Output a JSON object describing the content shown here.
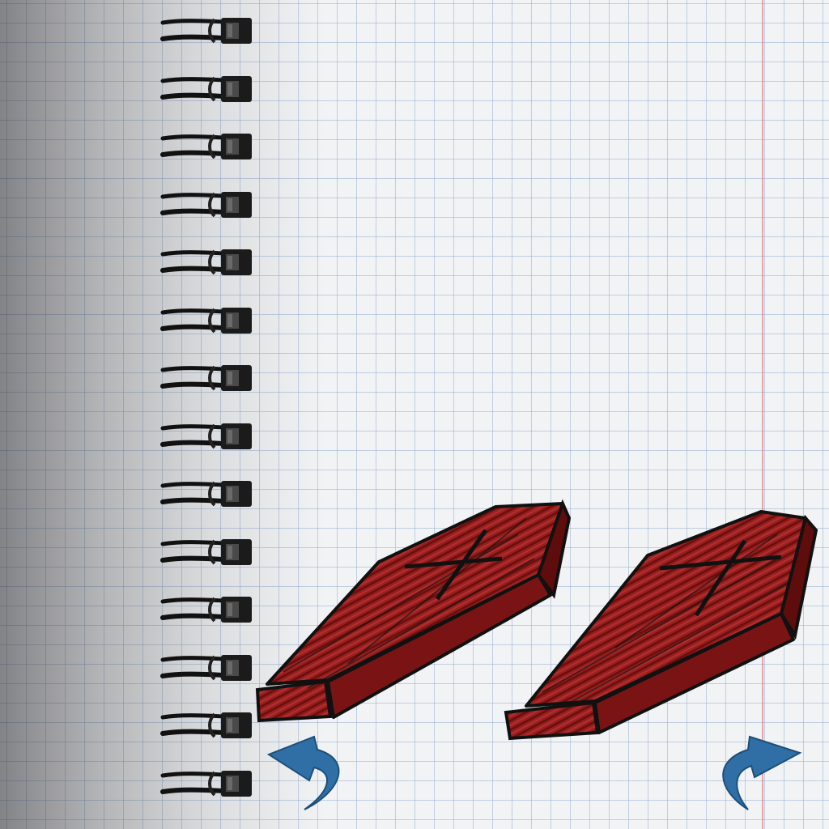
{
  "scene": {
    "paper_color": "#f2f3f4",
    "grid_color": "#96afd2",
    "margin_line_color": "#e16e78",
    "spiral_ring_count": 14
  },
  "coffins": [
    {
      "name": "coffin-left",
      "fill_color": "#8b1a1a",
      "outline_color": "#1a1a1a"
    },
    {
      "name": "coffin-right",
      "fill_color": "#8b1a1a",
      "outline_color": "#1a1a1a"
    }
  ],
  "navigation": {
    "back": {
      "icon": "curved-arrow-left-icon",
      "color": "#2f6fa6"
    },
    "next": {
      "icon": "curved-arrow-right-icon",
      "color": "#2f6fa6"
    }
  }
}
